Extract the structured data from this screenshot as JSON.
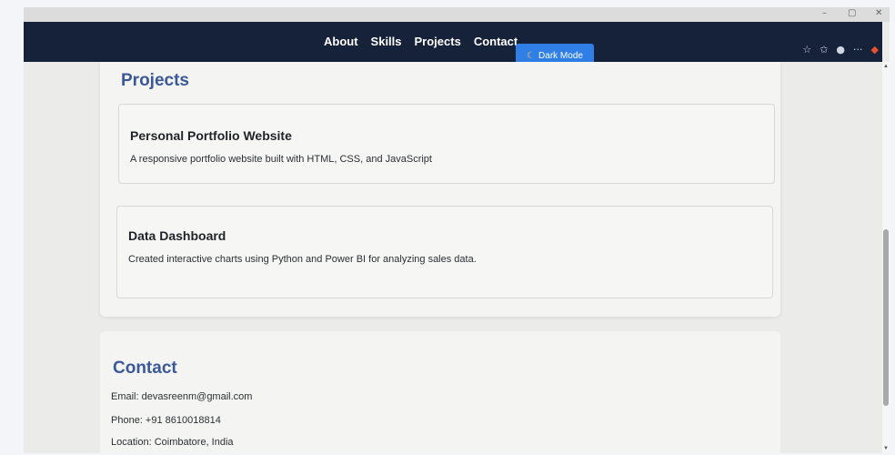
{
  "window": {
    "controls": [
      "–",
      "▢",
      "✕"
    ]
  },
  "nav": {
    "links": [
      "About",
      "Skills",
      "Projects",
      "Contact"
    ],
    "dark_mode_icon": "moon-icon",
    "dark_mode_label": "Dark Mode"
  },
  "toolbar_icons": [
    "star-icon",
    "favorites-icon",
    "profile-icon",
    "more-icon",
    "copilot-icon"
  ],
  "projects": {
    "title": "Projects",
    "items": [
      {
        "title": "Personal Portfolio Website",
        "description": "A responsive portfolio website built with HTML, CSS, and JavaScript"
      },
      {
        "title": "Data Dashboard",
        "description": "Created interactive charts using Python and Power BI for analyzing sales data."
      }
    ]
  },
  "contact": {
    "title": "Contact",
    "email": "Email: devasreenm@gmail.com",
    "phone": "Phone: +91 8610018814",
    "location": "Location: Coimbatore, India"
  },
  "colors": {
    "navbar": "#16213a",
    "accent_button": "#2f7fe6",
    "section_title": "#3b5899"
  }
}
